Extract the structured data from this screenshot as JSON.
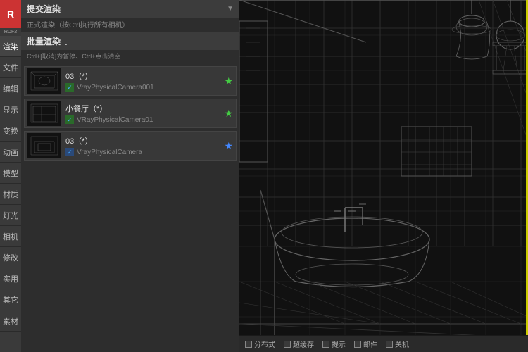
{
  "sidebar": {
    "logo": "R",
    "version": "RDF2",
    "items": [
      {
        "label": "渲染",
        "active": true
      },
      {
        "label": "文件"
      },
      {
        "label": "编辑"
      },
      {
        "label": "显示"
      },
      {
        "label": "变换"
      },
      {
        "label": "动画"
      },
      {
        "label": "模型"
      },
      {
        "label": "材质"
      },
      {
        "label": "灯光"
      },
      {
        "label": "相机"
      },
      {
        "label": "修改"
      },
      {
        "label": "实用"
      },
      {
        "label": "其它"
      },
      {
        "label": "素材"
      }
    ]
  },
  "panel": {
    "submit_title": "提交渲染",
    "submit_sub": "正式渲染（按Ctrl执行所有相机）",
    "batch_title": "批量渲染",
    "batch_dot": ".",
    "batch_hint": "Ctrl+[取消]为暂停、Ctrl+点击清空",
    "cameras": [
      {
        "name": "03（*）",
        "type": "VrayPhysicalCamera001",
        "star_color": "green",
        "check_color": "green"
      },
      {
        "name": "小餐厅（*）",
        "type": "VRayPhysicalCamera01",
        "star_color": "green",
        "check_color": "green"
      },
      {
        "name": "03（*）",
        "type": "VrayPhysicalCamera",
        "star_color": "blue",
        "check_color": "blue"
      }
    ]
  },
  "bottom": {
    "checkboxes": [
      {
        "label": "分布式"
      },
      {
        "label": "超缓存"
      },
      {
        "label": "提示"
      },
      {
        "label": "邮件"
      },
      {
        "label": "关机"
      }
    ]
  }
}
